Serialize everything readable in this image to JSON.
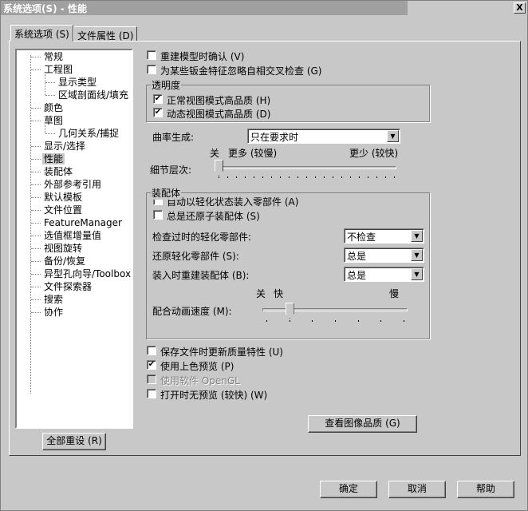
{
  "window": {
    "title": "系统选项(S) - 性能",
    "close": "X"
  },
  "tabs": [
    {
      "label": "系统选项 (S)"
    },
    {
      "label": "文件属性 (D)"
    }
  ],
  "tree": [
    {
      "label": "常规",
      "level": 0
    },
    {
      "label": "工程图",
      "level": 0
    },
    {
      "label": "显示类型",
      "level": 1
    },
    {
      "label": "区域剖面线/填充",
      "level": 1
    },
    {
      "label": "颜色",
      "level": 0
    },
    {
      "label": "草图",
      "level": 0
    },
    {
      "label": "几何关系/捕捉",
      "level": 1
    },
    {
      "label": "显示/选择",
      "level": 0
    },
    {
      "label": "性能",
      "level": 0,
      "selected": true
    },
    {
      "label": "装配体",
      "level": 0
    },
    {
      "label": "外部参考引用",
      "level": 0
    },
    {
      "label": "默认模板",
      "level": 0
    },
    {
      "label": "文件位置",
      "level": 0
    },
    {
      "label": "FeatureManager",
      "level": 0
    },
    {
      "label": "选值框增量值",
      "level": 0
    },
    {
      "label": "视图旋转",
      "level": 0
    },
    {
      "label": "备份/恢复",
      "level": 0
    },
    {
      "label": "异型孔向导/Toolbox",
      "level": 0
    },
    {
      "label": "文件探索器",
      "level": 0
    },
    {
      "label": "搜索",
      "level": 0
    },
    {
      "label": "协作",
      "level": 0
    }
  ],
  "reset_all": "全部重设 (R)",
  "top_checks": [
    {
      "label": "重建模型时确认 (V)",
      "checked": false
    },
    {
      "label": "为某些钣金特征忽略自相交叉检查 (G)",
      "checked": false
    }
  ],
  "transparency": {
    "title": "透明度",
    "checks": [
      {
        "label": "正常视图模式高品质 (H)",
        "checked": true
      },
      {
        "label": "动态视图模式高品质 (D)",
        "checked": true
      }
    ]
  },
  "curvature": {
    "label": "曲率生成:",
    "value": "只在要求时"
  },
  "lod": {
    "label": "细节层次:",
    "off": "关",
    "more": "更多 (较慢)",
    "less": "更少 (较快)",
    "value": 0
  },
  "assembly": {
    "title": "装配体",
    "checks": [
      {
        "label": "自动以轻化状态装入零部件 (A)",
        "checked": false
      },
      {
        "label": "总是还原子装配体 (S)",
        "checked": false
      }
    ],
    "rows": [
      {
        "label": "检查过时的轻化零部件:",
        "value": "不检查"
      },
      {
        "label": "还原轻化零部件 (S):",
        "value": "总是"
      },
      {
        "label": "装入时重建装配体 (B):",
        "value": "总是"
      }
    ],
    "mate_speed": {
      "label": "配合动画速度 (M):",
      "off": "关",
      "fast": "快",
      "slow": "慢",
      "value": 1
    }
  },
  "bottom_checks": [
    {
      "label": "保存文件时更新质量特性 (U)",
      "checked": false
    },
    {
      "label": "使用上色预览 (P)",
      "checked": true
    },
    {
      "label": "使用软件 OpenGL",
      "checked": false,
      "disabled": true
    },
    {
      "label": "打开时无预览 (较快) (W)",
      "checked": false
    }
  ],
  "image_quality": "查看图像品质 (G)",
  "ok": "确定",
  "cancel": "取消",
  "help": "帮助"
}
